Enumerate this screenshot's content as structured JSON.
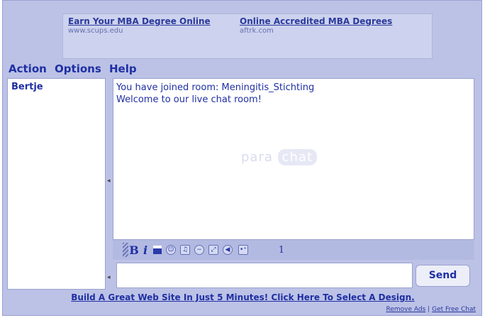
{
  "ads": [
    {
      "title": "Earn Your MBA Degree Online",
      "url": "www.scups.edu"
    },
    {
      "title": "Online Accredited MBA Degrees",
      "url": "aftrk.com"
    }
  ],
  "menu": {
    "items": [
      "Action",
      "Options",
      "Help"
    ]
  },
  "users": [
    "Bertje"
  ],
  "chat": {
    "messages": [
      "You have joined room: Meningitis_Stichting",
      "Welcome to our live chat room!"
    ],
    "watermark_left": "para",
    "watermark_right": "chat"
  },
  "toolbar": {
    "bold_label": "B",
    "italic_label": "i",
    "icons": [
      "smiley-icon",
      "music-icon",
      "minus-icon",
      "resize-icon",
      "sound-icon",
      "more-icon"
    ],
    "count": "1"
  },
  "input": {
    "value": ""
  },
  "send_label": "Send",
  "promo": "Build A Great Web Site In Just 5 Minutes! Click Here To Select A Design.",
  "footer": {
    "remove_ads": "Remove Ads",
    "separator": "|",
    "get_free_chat": "Get Free Chat"
  },
  "colors": {
    "accent": "#1f2fa3",
    "frame": "#bcc2e6",
    "toolbar": "#b3bae2"
  }
}
